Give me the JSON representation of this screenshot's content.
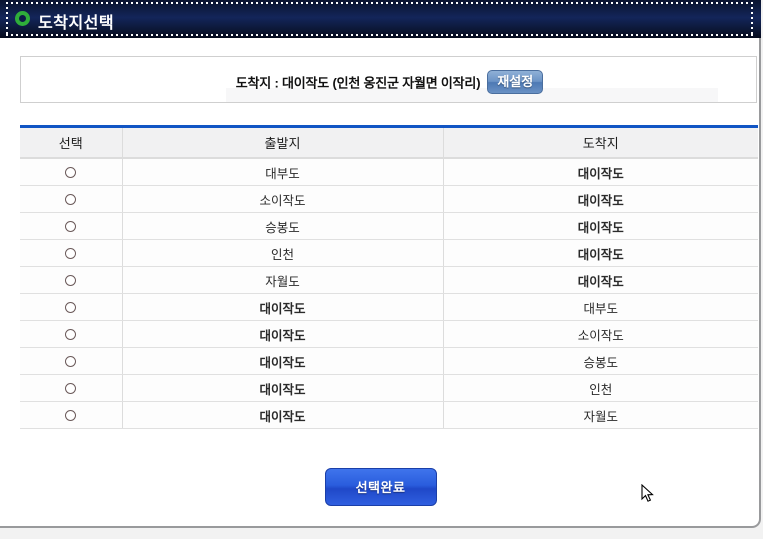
{
  "window": {
    "title": "도착지선택",
    "title_icon": "green-ring-icon"
  },
  "info": {
    "destination_label": "도착지 : 대이작도 (인천 옹진군 자월면 이작리)",
    "reset_button": "재설정"
  },
  "table": {
    "headers": [
      "선택",
      "출발지",
      "도착지"
    ],
    "rows": [
      {
        "departure": "대부도",
        "arrival": "대이작도",
        "highlight": "arrival"
      },
      {
        "departure": "소이작도",
        "arrival": "대이작도",
        "highlight": "arrival"
      },
      {
        "departure": "승봉도",
        "arrival": "대이작도",
        "highlight": "arrival"
      },
      {
        "departure": "인천",
        "arrival": "대이작도",
        "highlight": "arrival"
      },
      {
        "departure": "자월도",
        "arrival": "대이작도",
        "highlight": "arrival"
      },
      {
        "departure": "대이작도",
        "arrival": "대부도",
        "highlight": "departure"
      },
      {
        "departure": "대이작도",
        "arrival": "소이작도",
        "highlight": "departure"
      },
      {
        "departure": "대이작도",
        "arrival": "승봉도",
        "highlight": "departure"
      },
      {
        "departure": "대이작도",
        "arrival": "인천",
        "highlight": "departure"
      },
      {
        "departure": "대이작도",
        "arrival": "자월도",
        "highlight": "departure"
      }
    ]
  },
  "footer": {
    "submit_button": "선택완료"
  },
  "colors": {
    "titlebar_navy": "#0d1a3e",
    "accent_blue": "#1155c4",
    "highlight_maroon": "#5d1f22",
    "submit_blue": "#2a5ddd",
    "icon_green": "#2fae3a"
  }
}
